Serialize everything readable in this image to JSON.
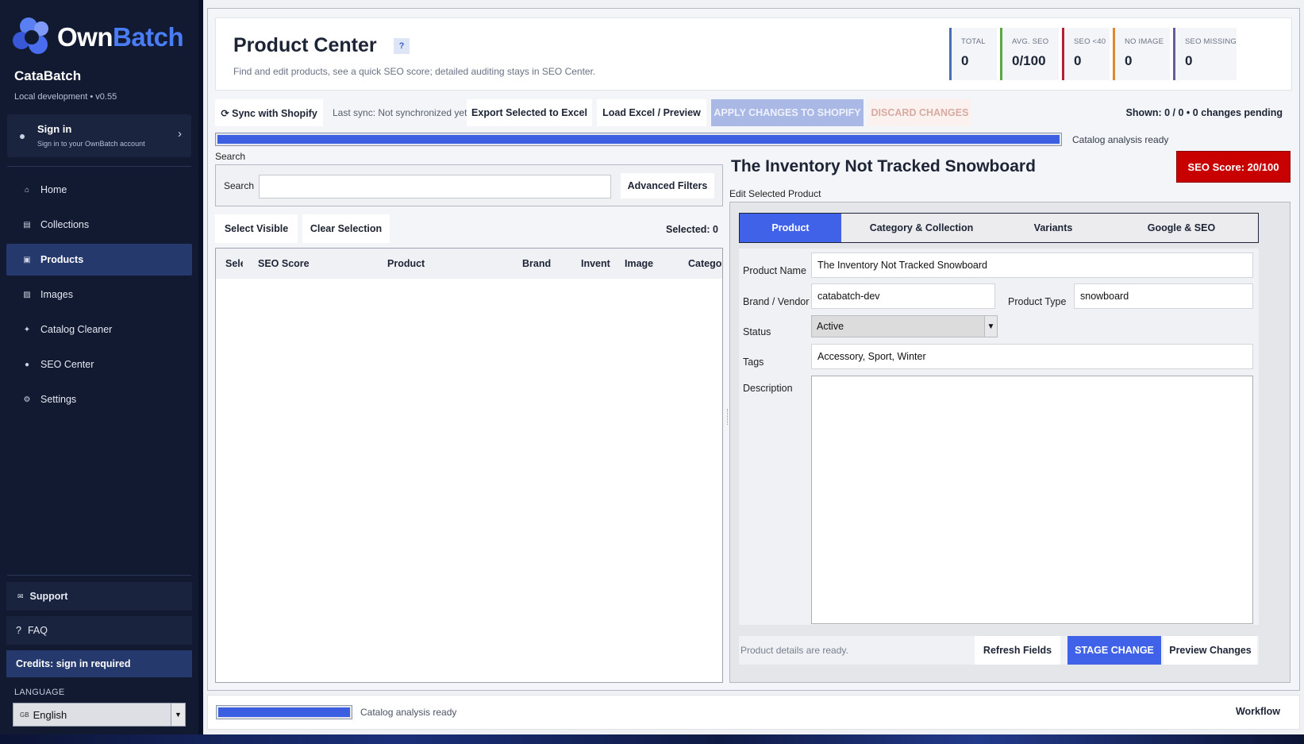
{
  "sidebar": {
    "logo_own": "Own",
    "logo_batch": "Batch",
    "app_name": "CataBatch",
    "app_version": "Local development • v0.55",
    "signin_title": "Sign in",
    "signin_sub": "Sign in to your OwnBatch account",
    "nav": [
      {
        "label": "Home",
        "icon": "home-icon",
        "glyph": "⌂"
      },
      {
        "label": "Collections",
        "icon": "collections-icon",
        "glyph": "▤"
      },
      {
        "label": "Products",
        "icon": "products-icon",
        "glyph": "▣",
        "active": true
      },
      {
        "label": "Images",
        "icon": "images-icon",
        "glyph": "▨"
      },
      {
        "label": "Catalog Cleaner",
        "icon": "sparkle-icon",
        "glyph": "✦"
      },
      {
        "label": "SEO Center",
        "icon": "seo-icon",
        "glyph": "●"
      },
      {
        "label": "Settings",
        "icon": "gear-icon",
        "glyph": "⚙"
      }
    ],
    "support_label": "Support",
    "faq_label": "FAQ",
    "credits_label": "Credits: sign in required",
    "language_label": "LANGUAGE",
    "language_value": "English"
  },
  "header": {
    "title": "Product Center",
    "help": "?",
    "subtitle": "Find and edit products, see a quick SEO score; detailed auditing stays in SEO Center.",
    "stats": [
      {
        "label": "TOTAL",
        "value": "0",
        "color": "#4a6fb0"
      },
      {
        "label": "AVG. SEO",
        "value": "0/100",
        "color": "#58a83e"
      },
      {
        "label": "SEO <40",
        "value": "0",
        "color": "#b2232e"
      },
      {
        "label": "NO IMAGE",
        "value": "0",
        "color": "#e0882f"
      },
      {
        "label": "SEO MISSING",
        "value": "0",
        "color": "#6a5a9e"
      }
    ]
  },
  "toolbar": {
    "sync_label": "⟳ Sync with Shopify",
    "last_sync": "Last sync: Not synchronized yet",
    "export_label": "Export Selected to Excel",
    "load_label": "Load Excel / Preview",
    "apply_label": "APPLY CHANGES TO SHOPIFY",
    "discard_label": "DISCARD CHANGES",
    "shown_text": "Shown: 0 / 0 • 0 changes pending"
  },
  "progress": {
    "label": "Catalog analysis ready",
    "fraction": 1.0
  },
  "search": {
    "caption": "Search",
    "label": "Search",
    "value": "",
    "advanced_label": "Advanced Filters",
    "select_visible_label": "Select Visible",
    "clear_selection_label": "Clear Selection",
    "selected_text": "Selected: 0"
  },
  "table": {
    "columns": [
      "Sele",
      "SEO Score",
      "Product",
      "Brand",
      "Invent",
      "Image",
      "Catego"
    ],
    "rows": []
  },
  "product": {
    "title": "The Inventory Not Tracked Snowboard",
    "seo_score": "SEO Score: 20/100",
    "edit_caption": "Edit Selected Product",
    "tabs": [
      "Product",
      "Category & Collection",
      "Variants",
      "Google & SEO"
    ],
    "active_tab": 0,
    "fields": {
      "name_label": "Product Name",
      "name_value": "The Inventory Not Tracked Snowboard",
      "brand_label": "Brand / Vendor",
      "brand_value": "catabatch-dev",
      "type_label": "Product Type",
      "type_value": "snowboard",
      "status_label": "Status",
      "status_value": "Active",
      "tags_label": "Tags",
      "tags_value": "Accessory, Sport, Winter",
      "description_label": "Description",
      "description_value": ""
    },
    "status_text": "Product details are ready.",
    "refresh_label": "Refresh Fields",
    "stage_label": "STAGE CHANGE",
    "preview_label": "Preview Changes"
  },
  "footer": {
    "progress_label": "Catalog analysis ready",
    "progress_fraction": 1.0,
    "workflow_label": "Workflow"
  }
}
